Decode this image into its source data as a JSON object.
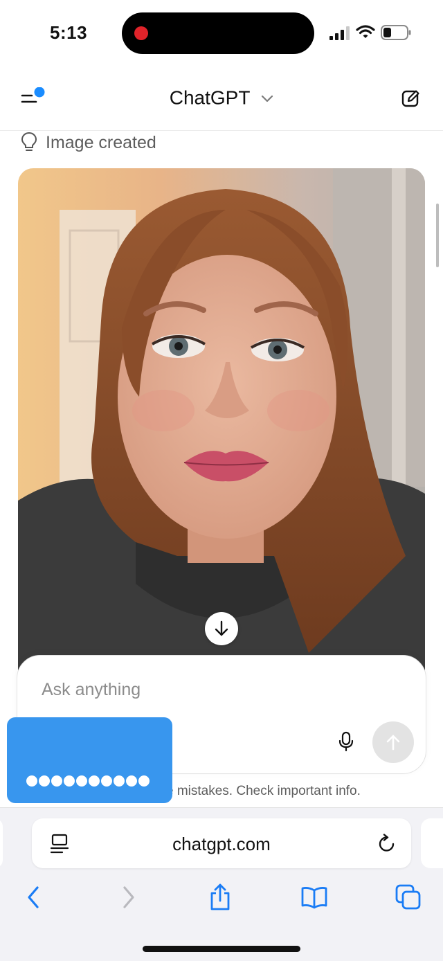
{
  "status_bar": {
    "time": "5:13",
    "recording_indicator_color": "#e0232a",
    "icons": [
      "cellular-signal-icon",
      "wifi-icon",
      "battery-icon"
    ]
  },
  "header": {
    "title": "ChatGPT",
    "menu_badge_color": "#1a8cff",
    "icons": [
      "sidebar-menu-icon",
      "chevron-down-icon",
      "new-chat-icon"
    ]
  },
  "message": {
    "status_label": "Image created",
    "status_icon": "lightbulb-icon",
    "image_alt": "Generated portrait photo of a red-haired woman in a dark hoodie"
  },
  "composer": {
    "placeholder": "Ask anything",
    "mic_icon": "microphone-icon",
    "send_icon": "arrow-up-icon",
    "disclaimer_visible": "e mistakes. Check important info."
  },
  "password_overlay": {
    "dot_count": 10,
    "color": "#3896ee"
  },
  "safari": {
    "url": "chatgpt.com",
    "icons": [
      "reader-icon",
      "reload-icon",
      "back-icon",
      "forward-icon",
      "share-icon",
      "bookmarks-icon",
      "tabs-icon"
    ],
    "accent_color": "#1a7cf5"
  }
}
